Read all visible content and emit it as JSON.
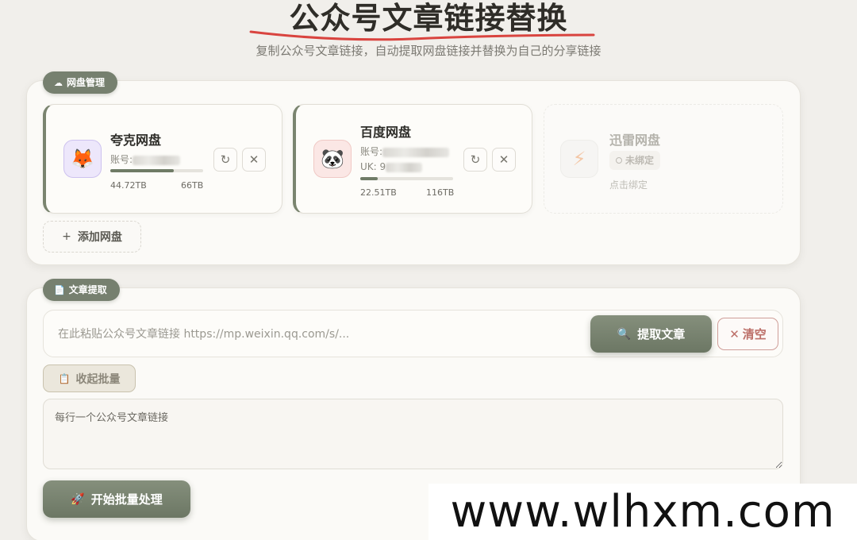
{
  "header": {
    "title": "公众号文章链接替换",
    "subtitle": "复制公众号文章链接，自动提取网盘链接并替换为自己的分享链接"
  },
  "netdisk_section": {
    "tag_icon": "cloud-icon",
    "tag_label": "网盘管理",
    "add_button_label": "添加网盘",
    "cards": [
      {
        "name": "夸克网盘",
        "status": "bound",
        "account_label": "账号:",
        "used": "44.72TB",
        "total": "66TB",
        "usage_fraction": 0.68,
        "logo": "fox-icon",
        "accent": "#7a846f"
      },
      {
        "name": "百度网盘",
        "status": "bound",
        "account_label": "账号:",
        "uk_label": "UK: 9",
        "used": "22.51TB",
        "total": "116TB",
        "usage_fraction": 0.19,
        "logo": "panda-icon",
        "accent": "#7a846f"
      },
      {
        "name": "迅雷网盘",
        "status": "unbound",
        "status_label": "未绑定",
        "hint": "点击绑定",
        "logo": "lightning-icon"
      }
    ]
  },
  "article_section": {
    "tag_icon": "document-icon",
    "tag_label": "文章提取",
    "url_placeholder": "在此粘贴公众号文章链接 https://mp.weixin.qq.com/s/...",
    "url_value": "",
    "extract_button_label": "提取文章",
    "clear_button_label": "清空",
    "collapse_button_label": "收起批量",
    "batch_placeholder": "每行一个公众号文章链接",
    "batch_button_label": "开始批量处理"
  },
  "watermark": "www.wlhxm.com",
  "colors": {
    "accent": "#76806f",
    "danger": "#bc6f68",
    "background": "#f1efeb",
    "title_underline": "#d9443f"
  }
}
